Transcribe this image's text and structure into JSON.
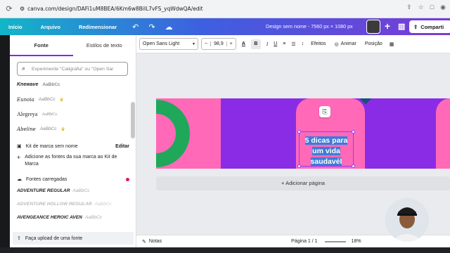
{
  "browser": {
    "url": "canva.com/design/DAFi1uM8BEA/6Km6w8BiIL7vFS_yqWdwQA/edit"
  },
  "topbar": {
    "home_label": "Início",
    "file_label": "Arquivo",
    "resize_label": "Redimensionar",
    "doc_title": "Design sem nome - 7560 px × 1080 px",
    "share_label": "Comparti"
  },
  "panel": {
    "tab_fonts": "Fonte",
    "tab_styles": "Estilos de texto",
    "search_placeholder": "Experimente \"Caligrafia\" ou \"Open Sar",
    "fonts": [
      {
        "name": "Knewave",
        "demo": "AaBbCc"
      },
      {
        "name": "Eunoia",
        "demo": "AaBbCc"
      },
      {
        "name": "Alegreya",
        "demo": "AaBbCc"
      },
      {
        "name": "Abeline",
        "demo": "AaBbCc"
      }
    ],
    "brand_kit_title": "Kit de marca sem nome",
    "brand_edit": "Editar",
    "brand_add": "Adicione as fontes da sua marca ao Kit de Marca",
    "loaded_title": "Fontes carregadas",
    "loaded_fonts": [
      {
        "name": "ADVENTURE REGULAR",
        "demo": "AaBbCc"
      },
      {
        "name": "ADVENTURE HOLLOW REGULAR",
        "demo": "AaBbCc"
      },
      {
        "name": "AVENGEANCE HEROIC AVEN",
        "demo": "AaBbCc"
      }
    ],
    "upload_label": "Faça upload de uma fonte"
  },
  "toolbar": {
    "font_name": "Open Sans Light",
    "minus": "−",
    "font_size": "98,9",
    "plus": "+",
    "effects": "Efeitos",
    "animate": "Animar",
    "position": "Posição"
  },
  "canvas": {
    "headline_lines": [
      "5 dicas para",
      "um vida",
      "saudavél"
    ],
    "add_page": "+ Adicionar página"
  },
  "bottombar": {
    "notes": "Notas",
    "page": "Página 1 / 1",
    "zoom": "18%"
  },
  "colors": {
    "purple": "#8a2ce6",
    "pink": "#ff69b8",
    "green": "#1fa85a",
    "selection": "#8b3dff"
  }
}
